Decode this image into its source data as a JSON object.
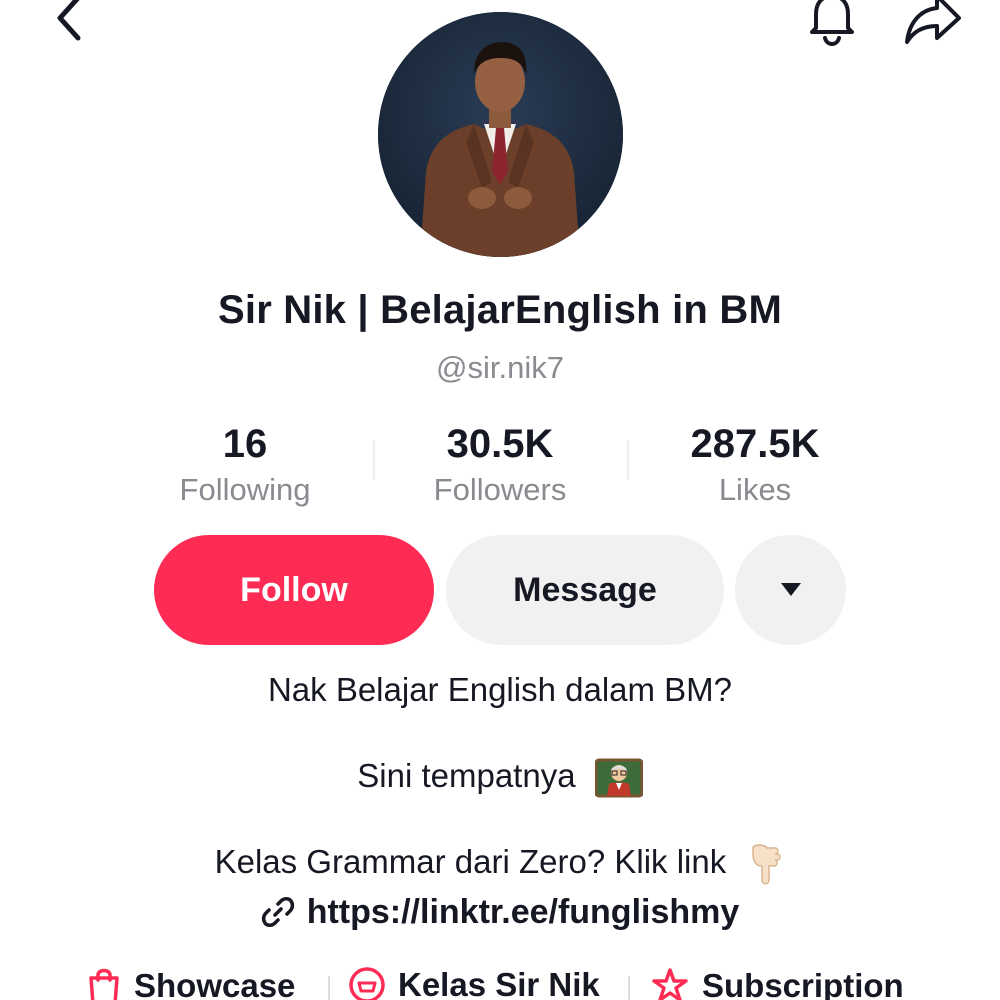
{
  "header": {
    "back_icon": "chevron-left-icon",
    "bell_icon": "bell-icon",
    "share_icon": "share-arrow-icon"
  },
  "profile": {
    "display_name": "Sir Nik | BelajarEnglish in BM",
    "username": "@sir.nik7"
  },
  "stats": [
    {
      "value": "16",
      "label": "Following"
    },
    {
      "value": "30.5K",
      "label": "Followers"
    },
    {
      "value": "287.5K",
      "label": "Likes"
    }
  ],
  "actions": {
    "follow_label": "Follow",
    "message_label": "Message",
    "more_icon": "caret-down-icon"
  },
  "bio": {
    "line1": "Nak Belajar English dalam BM?",
    "line2": "Sini tempatnya",
    "line3": "Kelas Grammar dari Zero? Klik link",
    "link": "https://linktr.ee/funglishmy"
  },
  "chips": [
    {
      "label": "Showcase",
      "icon": "shopping-bag-icon"
    },
    {
      "label": "Kelas Sir Nik",
      "icon": "course-icon"
    },
    {
      "label": "Subscription",
      "icon": "subscription-star-icon"
    }
  ],
  "colors": {
    "accent": "#fe2c55",
    "text": "#161823",
    "muted": "#8a8b91",
    "button_gray": "#f1f1f2"
  }
}
